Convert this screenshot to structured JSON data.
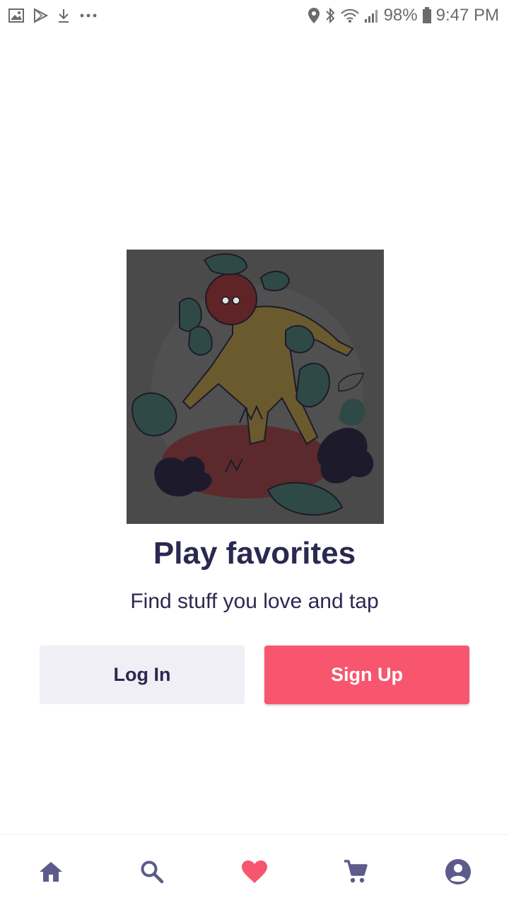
{
  "status_bar": {
    "left_icons": [
      "image-icon",
      "play-store-icon",
      "download-icon",
      "more-dots-icon"
    ],
    "right_icons": [
      "location-icon",
      "bluetooth-icon",
      "wifi-icon",
      "signal-icon",
      "battery-icon"
    ],
    "battery": "98%",
    "time": "9:47 PM"
  },
  "onboarding": {
    "illustration": "astronaut-illustration",
    "title": "Play favorites",
    "subtitle": "Find stuff you love and tap"
  },
  "buttons": {
    "login": "Log In",
    "signup": "Sign Up"
  },
  "bottom_nav": {
    "items": [
      "home-icon",
      "search-icon",
      "heart-icon",
      "cart-icon",
      "account-icon"
    ],
    "active": "heart-icon"
  },
  "colors": {
    "primary_text": "#2b2950",
    "accent": "#f7566e",
    "nav_icon": "#5d5a8c",
    "secondary_button": "#f0eff5"
  }
}
